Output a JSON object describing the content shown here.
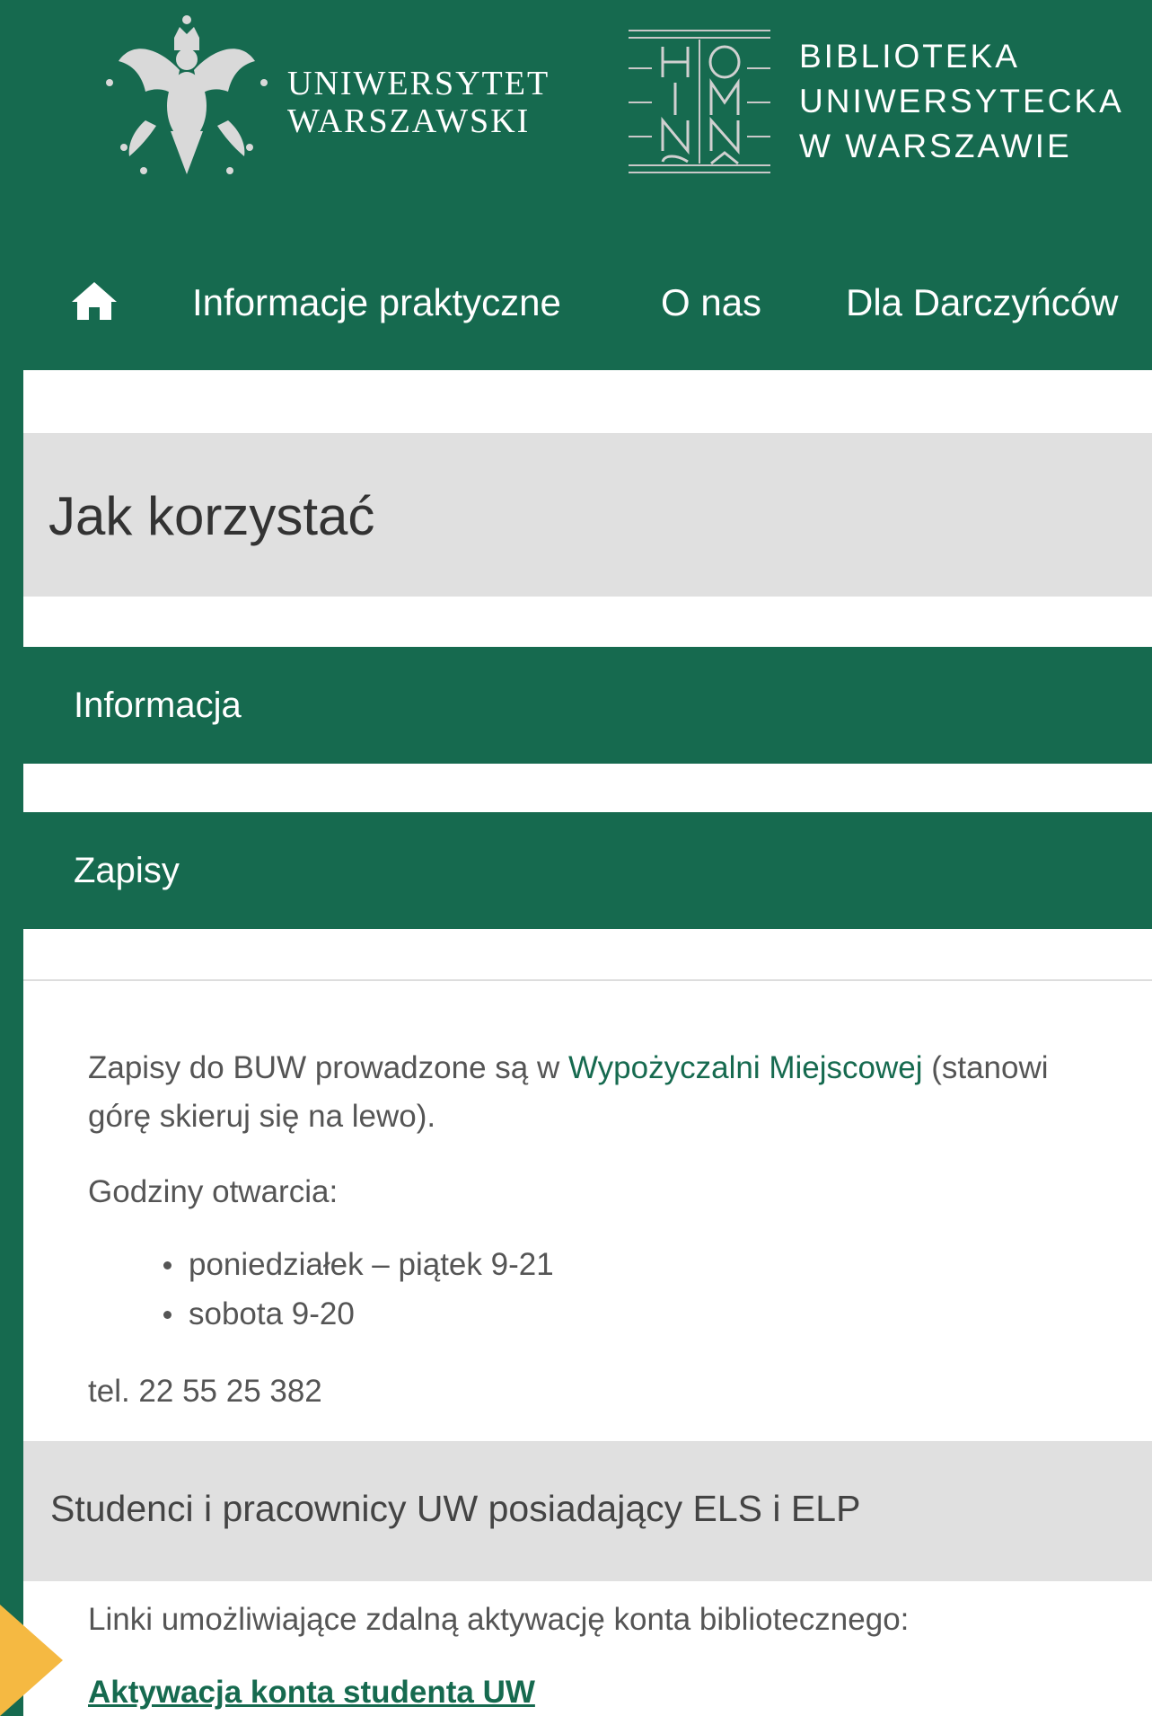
{
  "header": {
    "university_name_line1": "UNIWERSYTET",
    "university_name_line2": "WARSZAWSKI",
    "library_name_line1": "BIBLIOTEKA",
    "library_name_line2": "UNIWERSYTECKA",
    "library_name_line3": "W WARSZAWIE"
  },
  "nav": {
    "home_icon": "home-icon",
    "items": [
      {
        "label": "Informacje praktyczne"
      },
      {
        "label": "O nas"
      },
      {
        "label": "Dla Darczyńców"
      }
    ]
  },
  "page_title": "Jak korzystać",
  "accordion": {
    "items": [
      {
        "label": "Informacja"
      },
      {
        "label": "Zapisy"
      }
    ]
  },
  "zapisy": {
    "text_before_link": "Zapisy do BUW prowadzone są w ",
    "link_text": "Wypożyczalni Miejscowej",
    "text_after_link": " (stanowi",
    "text_line2": "górę skieruj się na lewo).",
    "hours_label": "Godziny otwarcia:",
    "hours": [
      "poniedziałek – piątek 9-21",
      "sobota 9-20"
    ],
    "phone": "tel. 22 55 25 382"
  },
  "els_section": {
    "title": "Studenci i pracownicy UW posiadający ELS i ELP",
    "intro": "Linki umożliwiające zdalną aktywację konta bibliotecznego:",
    "link": "Aktywacja konta studenta UW"
  },
  "colors": {
    "brand_green": "#166a4f",
    "panel_gray": "#e0e0e0",
    "accent_orange": "#f5b942"
  }
}
